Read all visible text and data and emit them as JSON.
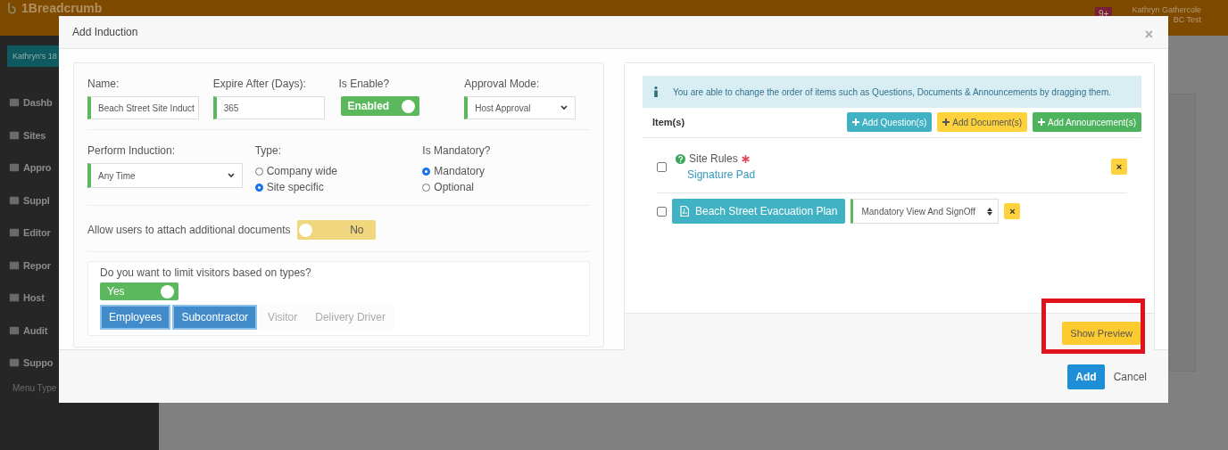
{
  "background": {
    "logo": "1Breadcrumb",
    "badge": "9+",
    "user_name": "Kathryn Gathercole",
    "user_org": "BC Test",
    "site_button": "Kathryn's 18",
    "sidebar": [
      {
        "label": "Dashb"
      },
      {
        "label": "Sites"
      },
      {
        "label": "Appro"
      },
      {
        "label": "Suppl"
      },
      {
        "label": "Editor"
      },
      {
        "label": "Repor"
      },
      {
        "label": "Host"
      },
      {
        "label": "Audit"
      },
      {
        "label": "Suppo"
      }
    ],
    "menu_type": "Menu Type"
  },
  "modal": {
    "title": "Add Induction",
    "close": "×",
    "left": {
      "name": {
        "label": "Name:",
        "value": "Beach Street Site Induct"
      },
      "expire": {
        "label": "Expire After (Days):",
        "value": "365"
      },
      "is_enable": {
        "label": "Is Enable?",
        "toggle": {
          "text": "Enabled",
          "on": true
        }
      },
      "approval_mode": {
        "label": "Approval Mode:",
        "value": "Host Approval"
      },
      "perform_induction": {
        "label": "Perform Induction:",
        "value": "Any Time"
      },
      "type": {
        "label": "Type:",
        "options": [
          {
            "label": "Company wide",
            "selected": false
          },
          {
            "label": "Site specific",
            "selected": true
          }
        ]
      },
      "is_mandatory": {
        "label": "Is Mandatory?",
        "options": [
          {
            "label": "Mandatory",
            "selected": true
          },
          {
            "label": "Optional",
            "selected": false
          }
        ]
      },
      "attach_docs": {
        "label": "Allow users to attach additional documents",
        "toggle": {
          "text": "No",
          "on": false
        }
      },
      "limit_visitors": {
        "question": "Do you want to limit visitors based on types?",
        "toggle": {
          "text": "Yes",
          "on": true
        },
        "types": [
          {
            "label": "Employees",
            "selected": true
          },
          {
            "label": "Subcontractor",
            "selected": true
          },
          {
            "label": "Visitor",
            "selected": false
          },
          {
            "label": "Delivery Driver",
            "selected": false
          }
        ]
      }
    },
    "right": {
      "info": "You are able to change the order of items such as Questions, Documents & Announcements by dragging them.",
      "items_label": "Item(s)",
      "add_buttons": [
        {
          "label": "Add Question(s)",
          "kind": "question"
        },
        {
          "label": "Add Document(s)",
          "kind": "document"
        },
        {
          "label": "Add Announcement(s)",
          "kind": "announcement"
        }
      ],
      "items": [
        {
          "kind": "question",
          "checked": false,
          "title": "Site Rules",
          "required": true,
          "subtitle": "Signature Pad",
          "remove": "×"
        },
        {
          "kind": "document",
          "checked": false,
          "title": "Beach Street Evacuation Plan",
          "mode": "Mandatory View And SignOff",
          "remove": "×"
        }
      ],
      "preview": {
        "label": "Show Preview",
        "highlighted": true
      }
    },
    "footer": {
      "add": "Add",
      "cancel": "Cancel"
    }
  }
}
